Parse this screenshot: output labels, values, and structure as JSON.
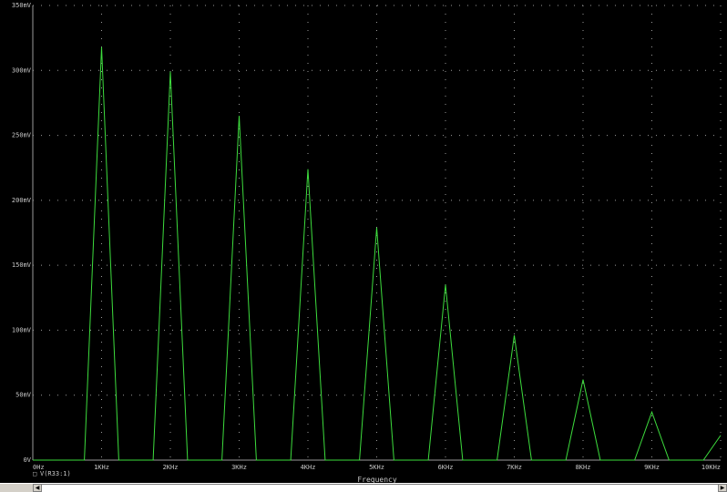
{
  "colors": {
    "background": "#000000",
    "trace": "#3ddc3d",
    "grid": "#9a9a9a",
    "text": "#c8c8c8"
  },
  "chart_data": {
    "type": "line",
    "title": "",
    "xlabel": "Frequency",
    "ylabel": "",
    "xlim": [
      0,
      10
    ],
    "ylim": [
      0,
      350
    ],
    "x_unit": "KHz",
    "y_unit": "mV",
    "grid": true,
    "legend_position": "bottom-left",
    "x_tick_labels": [
      "0Hz",
      "1KHz",
      "2KHz",
      "3KHz",
      "4KHz",
      "5KHz",
      "6KHz",
      "7KHz",
      "8KHz",
      "9KHz",
      "10KHz"
    ],
    "y_tick_labels": [
      "0V",
      "50mV",
      "100mV",
      "150mV",
      "200mV",
      "250mV",
      "300mV",
      "350mV"
    ],
    "series": [
      {
        "name": "V(R33:1)",
        "x": [
          0,
          0.75,
          1.0,
          1.25,
          1.75,
          2.0,
          2.25,
          2.75,
          3.0,
          3.25,
          3.75,
          4.0,
          4.25,
          4.75,
          5.0,
          5.25,
          5.75,
          6.0,
          6.25,
          6.75,
          7.0,
          7.25,
          7.75,
          8.0,
          8.25,
          8.75,
          9.0,
          9.25,
          9.75,
          10.0
        ],
        "y": [
          0,
          0,
          318,
          0,
          0,
          299,
          0,
          0,
          265,
          0,
          0,
          224,
          0,
          0,
          179,
          0,
          0,
          135,
          0,
          0,
          96,
          0,
          0,
          62,
          0,
          0,
          37,
          0,
          0,
          19
        ]
      }
    ]
  },
  "legend": {
    "marker": "□",
    "label": "V(R33:1)"
  },
  "scrollbar": {
    "left_arrow": "◀",
    "right_arrow": "▶"
  }
}
